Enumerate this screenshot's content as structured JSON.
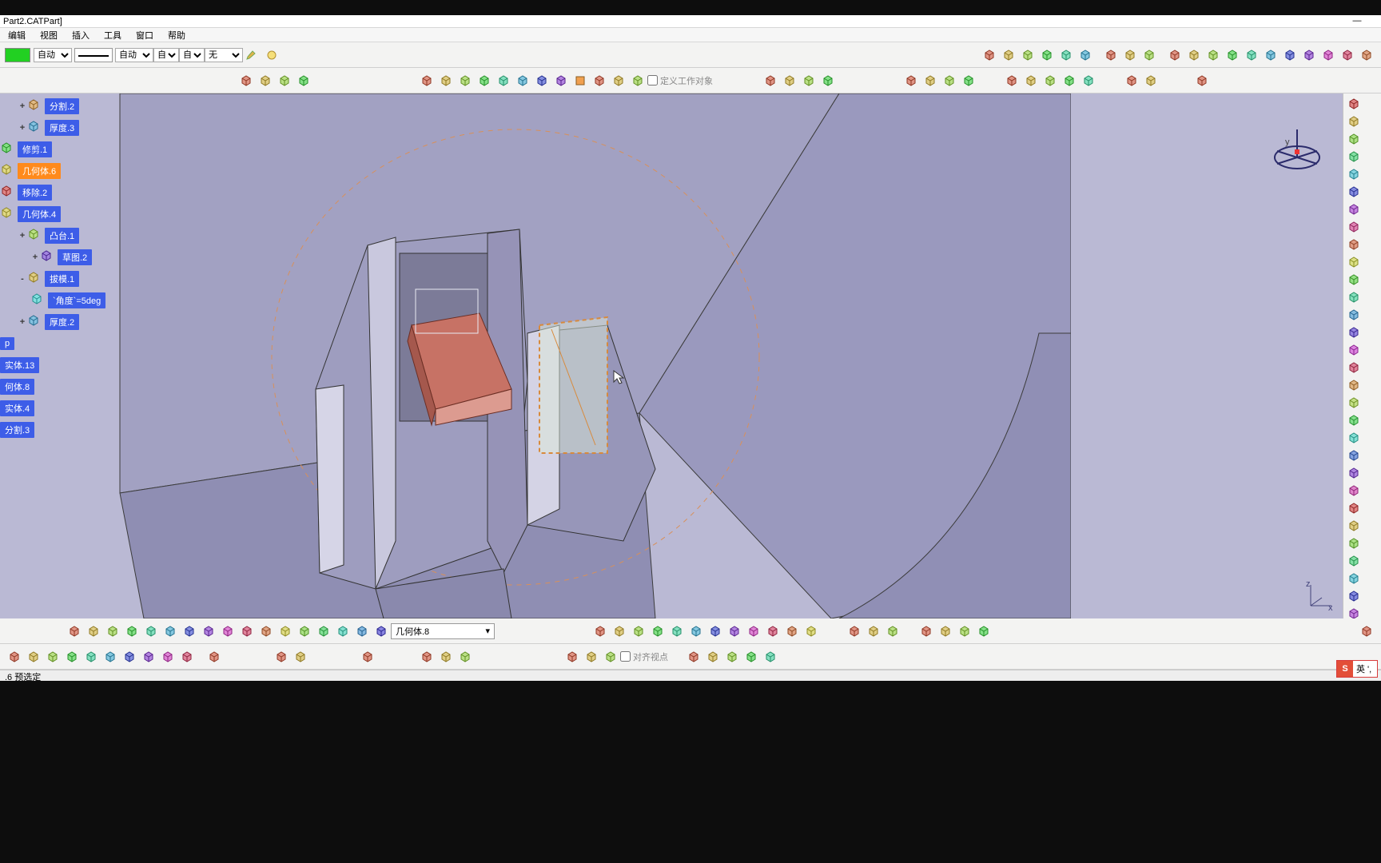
{
  "window": {
    "title": "Part2.CATPart]"
  },
  "menu": {
    "items": [
      "编辑",
      "视图",
      "插入",
      "工具",
      "窗口",
      "帮助"
    ]
  },
  "props_toolbar": {
    "color": "#22d022",
    "auto1": "自动",
    "auto2": "自动",
    "auto3": "自动",
    "auto4": "自动",
    "none": "无"
  },
  "work_object_checkbox": "定义工作对象",
  "selection_combo": "几何体.8",
  "axis_view": {
    "y": "y",
    "x": "x",
    "z": "z"
  },
  "tree": [
    {
      "type": "node",
      "icon": "split",
      "label": "分割.2",
      "indent": 1,
      "expander": "+"
    },
    {
      "type": "node",
      "icon": "thick",
      "label": "厚度.3",
      "indent": 1,
      "expander": "+"
    },
    {
      "type": "node",
      "icon": "trim",
      "label": "修剪.1",
      "indent": 0
    },
    {
      "type": "node",
      "icon": "body",
      "label": "几何体.6",
      "indent": 0,
      "sel": true
    },
    {
      "type": "node",
      "icon": "remove",
      "label": "移除.2",
      "indent": 0
    },
    {
      "type": "node",
      "icon": "body",
      "label": "几何体.4",
      "indent": 0
    },
    {
      "type": "node",
      "icon": "pad",
      "label": "凸台.1",
      "indent": 1,
      "expander": "+"
    },
    {
      "type": "node",
      "icon": "sketch",
      "label": "草图.2",
      "indent": 2,
      "expander": "+"
    },
    {
      "type": "node",
      "icon": "draft",
      "label": "拔模.1",
      "indent": 1,
      "expander": "-"
    },
    {
      "type": "node",
      "icon": "param",
      "label": "`角度`=5deg",
      "indent": 2
    },
    {
      "type": "node",
      "icon": "thick",
      "label": "厚度.2",
      "indent": 1,
      "expander": "+"
    },
    {
      "type": "node",
      "icon": "",
      "label": "p",
      "indent": 0,
      "small": true
    },
    {
      "type": "node",
      "icon": "",
      "label": "实体.13",
      "indent": 0
    },
    {
      "type": "node",
      "icon": "",
      "label": "何体.8",
      "indent": 0
    },
    {
      "type": "node",
      "icon": "",
      "label": "实体.4",
      "indent": 0
    },
    {
      "type": "node",
      "icon": "",
      "label": "分割.3",
      "indent": 0
    }
  ],
  "bottom_checkbox": "对齐视点",
  "status": ".6 预选定",
  "ime": "英 ',",
  "icon_groups": {
    "row1_right1": [
      "box",
      "box2",
      "box3",
      "cage",
      "compass",
      "warp"
    ],
    "row1_right2": [
      "a",
      "b",
      "c"
    ],
    "row1_right3": [
      "a",
      "b",
      "c",
      "d",
      "e",
      "f",
      "g",
      "h",
      "i",
      "j",
      "k"
    ],
    "row2_a": [
      "a",
      "b",
      "c",
      "d"
    ],
    "row2_b": [
      "a",
      "b",
      "c",
      "d",
      "e",
      "f",
      "g",
      "h"
    ],
    "row2_c": [
      "a",
      "b",
      "c"
    ],
    "row2_d": [
      "a",
      "b",
      "c",
      "d"
    ],
    "row2_e": [
      "a",
      "b",
      "c",
      "d"
    ],
    "row2_f": [
      "a",
      "b",
      "c",
      "d",
      "e"
    ],
    "row2_g": [
      "a",
      "b"
    ],
    "row2_h": [
      "a"
    ],
    "bottom1_a": [
      "a",
      "b",
      "c",
      "d",
      "e",
      "f",
      "g",
      "h",
      "i",
      "j",
      "k",
      "l",
      "m",
      "n",
      "o",
      "p",
      "q"
    ],
    "bottom1_b": [
      "a",
      "b",
      "c",
      "d",
      "e",
      "f",
      "g",
      "h",
      "i",
      "j",
      "k",
      "l"
    ],
    "bottom1_c": [
      "a",
      "b",
      "c"
    ],
    "bottom1_d": [
      "a",
      "b",
      "c",
      "d"
    ],
    "bottom1_e": [
      "a"
    ],
    "bottom2_a": [
      "a",
      "b",
      "c",
      "d",
      "e",
      "f",
      "g",
      "h",
      "i",
      "j"
    ],
    "bottom2_b": [
      "a"
    ],
    "bottom2_c": [
      "a",
      "b"
    ],
    "bottom2_d": [
      "a"
    ],
    "bottom2_e": [
      "a",
      "b",
      "c"
    ],
    "bottom2_f": [
      "a",
      "b",
      "c"
    ],
    "bottom2_g": [
      "a",
      "b",
      "c",
      "d",
      "e"
    ]
  },
  "right_icons_count": 40
}
